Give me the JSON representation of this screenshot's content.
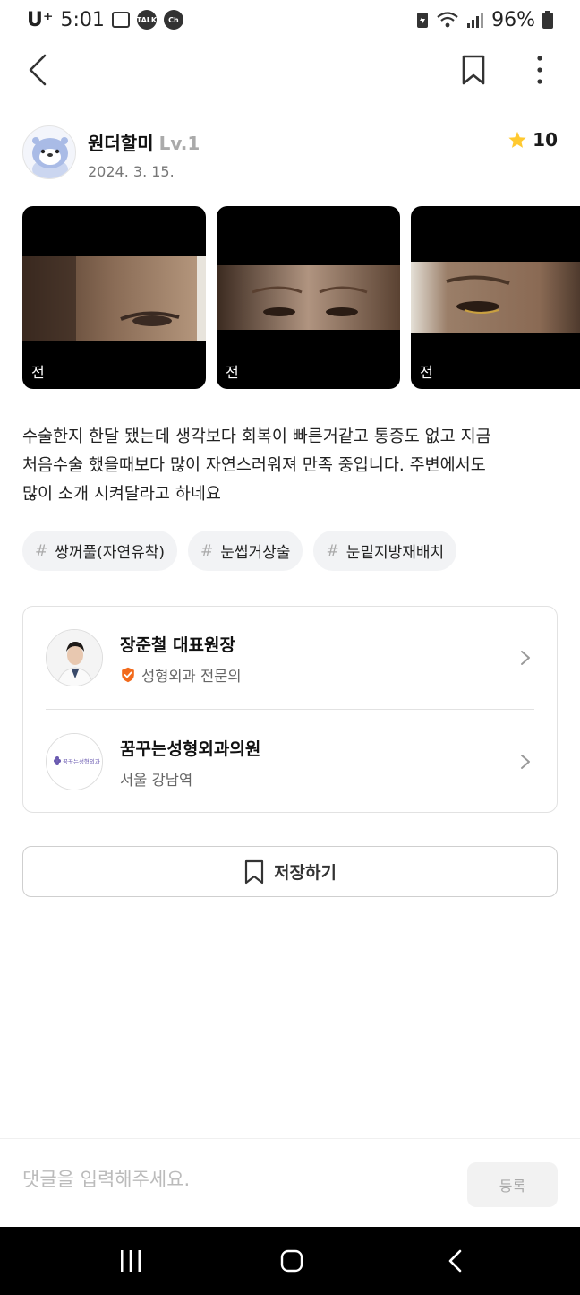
{
  "status_bar": {
    "carrier": "U⁺",
    "time": "5:01",
    "notification_icons": [
      "image-icon",
      "kakaotalk-icon",
      "kakao-channel-icon"
    ],
    "kakaotalk_badge": "TALK",
    "channel_badge": "Ch",
    "battery": "96%"
  },
  "author": {
    "name": "원더할미",
    "level": "Lv.1",
    "date": "2024. 3. 15.",
    "rating": "10"
  },
  "photos": [
    {
      "label": "전"
    },
    {
      "label": "전"
    },
    {
      "label": "전"
    }
  ],
  "review_text": {
    "line1": "수술한지 한달 됐는데 생각보다 회복이  빠른거같고 통증도 없고 지금",
    "line2": "처음수술 했을때보다 많이 자연스러워져 만족 중입니다. 주변에서도",
    "line3": "많이 소개 시켜달라고 하네요"
  },
  "tags": [
    {
      "hash": "#",
      "label": "쌍꺼풀(자연유착)"
    },
    {
      "hash": "#",
      "label": "눈썹거상술"
    },
    {
      "hash": "#",
      "label": "눈밑지방재배치"
    }
  ],
  "doctor": {
    "name": "장준철 대표원장",
    "specialty": "성형외과 전문의"
  },
  "clinic": {
    "name": "꿈꾸는성형외과의원",
    "logo_text": "꿈꾸는성형외과",
    "location": "서울 강남역"
  },
  "save_button": {
    "label": "저장하기"
  },
  "comment": {
    "placeholder": "댓글을 입력해주세요.",
    "submit_label": "등록"
  },
  "colors": {
    "star": "#FFC930",
    "verified_badge": "#F26A1B",
    "border": "#E2E2E2"
  }
}
